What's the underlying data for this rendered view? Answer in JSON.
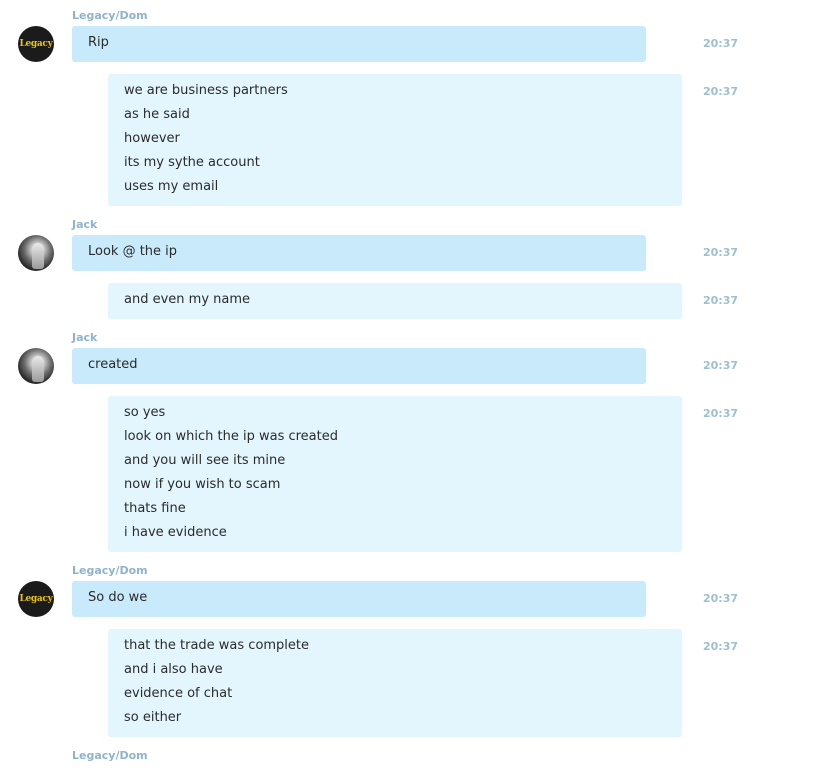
{
  "messages": [
    {
      "type": "name",
      "text": "Legacy/Dom"
    },
    {
      "type": "first",
      "avatar": "legacy-logo",
      "lines": [
        "Rip"
      ],
      "time": "20:37"
    },
    {
      "type": "cont",
      "lines": [
        "we are business partners",
        "as he said",
        "however",
        "its my sythe account",
        "uses my email"
      ],
      "time": "20:37"
    },
    {
      "type": "name",
      "text": "Jack"
    },
    {
      "type": "first",
      "avatar": "jack-photo",
      "lines": [
        "Look @ the ip"
      ],
      "time": "20:37"
    },
    {
      "type": "cont",
      "lines": [
        "and even my name"
      ],
      "time": "20:37"
    },
    {
      "type": "name",
      "text": "Jack"
    },
    {
      "type": "first",
      "avatar": "jack-photo",
      "lines": [
        "created"
      ],
      "time": "20:37"
    },
    {
      "type": "cont",
      "lines": [
        "so yes",
        "look on which the ip was created",
        "and you will see its mine",
        "now if you wish to scam",
        "thats fine",
        "i have evidence"
      ],
      "time": "20:37"
    },
    {
      "type": "name",
      "text": "Legacy/Dom"
    },
    {
      "type": "first",
      "avatar": "legacy-logo",
      "lines": [
        "So do we"
      ],
      "time": "20:37"
    },
    {
      "type": "cont",
      "lines": [
        "that the trade was complete",
        "and i also have",
        "evidence of chat",
        "so either"
      ],
      "time": "20:37"
    },
    {
      "type": "name",
      "text": "Legacy/Dom"
    }
  ],
  "avatar_text": {
    "legacy-logo": "Legacy"
  },
  "colors": {
    "sender_name": "#8fb3c9",
    "first_bubble": "#c8eafb",
    "cont_bubble": "#e3f5fd",
    "timestamp": "#9ebfd2"
  }
}
